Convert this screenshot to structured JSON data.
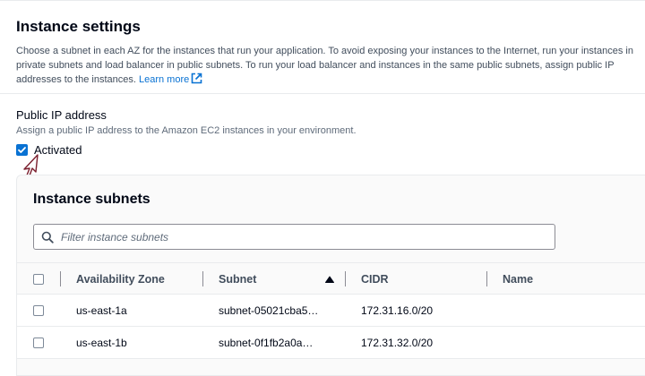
{
  "section": {
    "title": "Instance settings",
    "description": "Choose a subnet in each AZ for the instances that run your application. To avoid exposing your instances to the Internet, run your instances in private subnets and load balancer in public subnets. To run your load balancer and instances in the same public subnets, assign public IP addresses to the instances.",
    "learn_more": "Learn more"
  },
  "public_ip": {
    "label": "Public IP address",
    "description": "Assign a public IP address to the Amazon EC2 instances in your environment.",
    "checkbox_label": "Activated",
    "checked": true
  },
  "subnets": {
    "title": "Instance subnets",
    "filter_placeholder": "Filter instance subnets",
    "columns": [
      "Availability Zone",
      "Subnet",
      "CIDR",
      "Name"
    ],
    "sort_column": "Subnet",
    "rows": [
      {
        "az": "us-east-1a",
        "subnet": "subnet-05021cba5…",
        "cidr": "172.31.16.0/20",
        "name": ""
      },
      {
        "az": "us-east-1b",
        "subnet": "subnet-0f1fb2a0a…",
        "cidr": "172.31.32.0/20",
        "name": ""
      }
    ]
  },
  "colors": {
    "accent": "#0972d3",
    "annotation_arrow": "#7b1f2e"
  }
}
